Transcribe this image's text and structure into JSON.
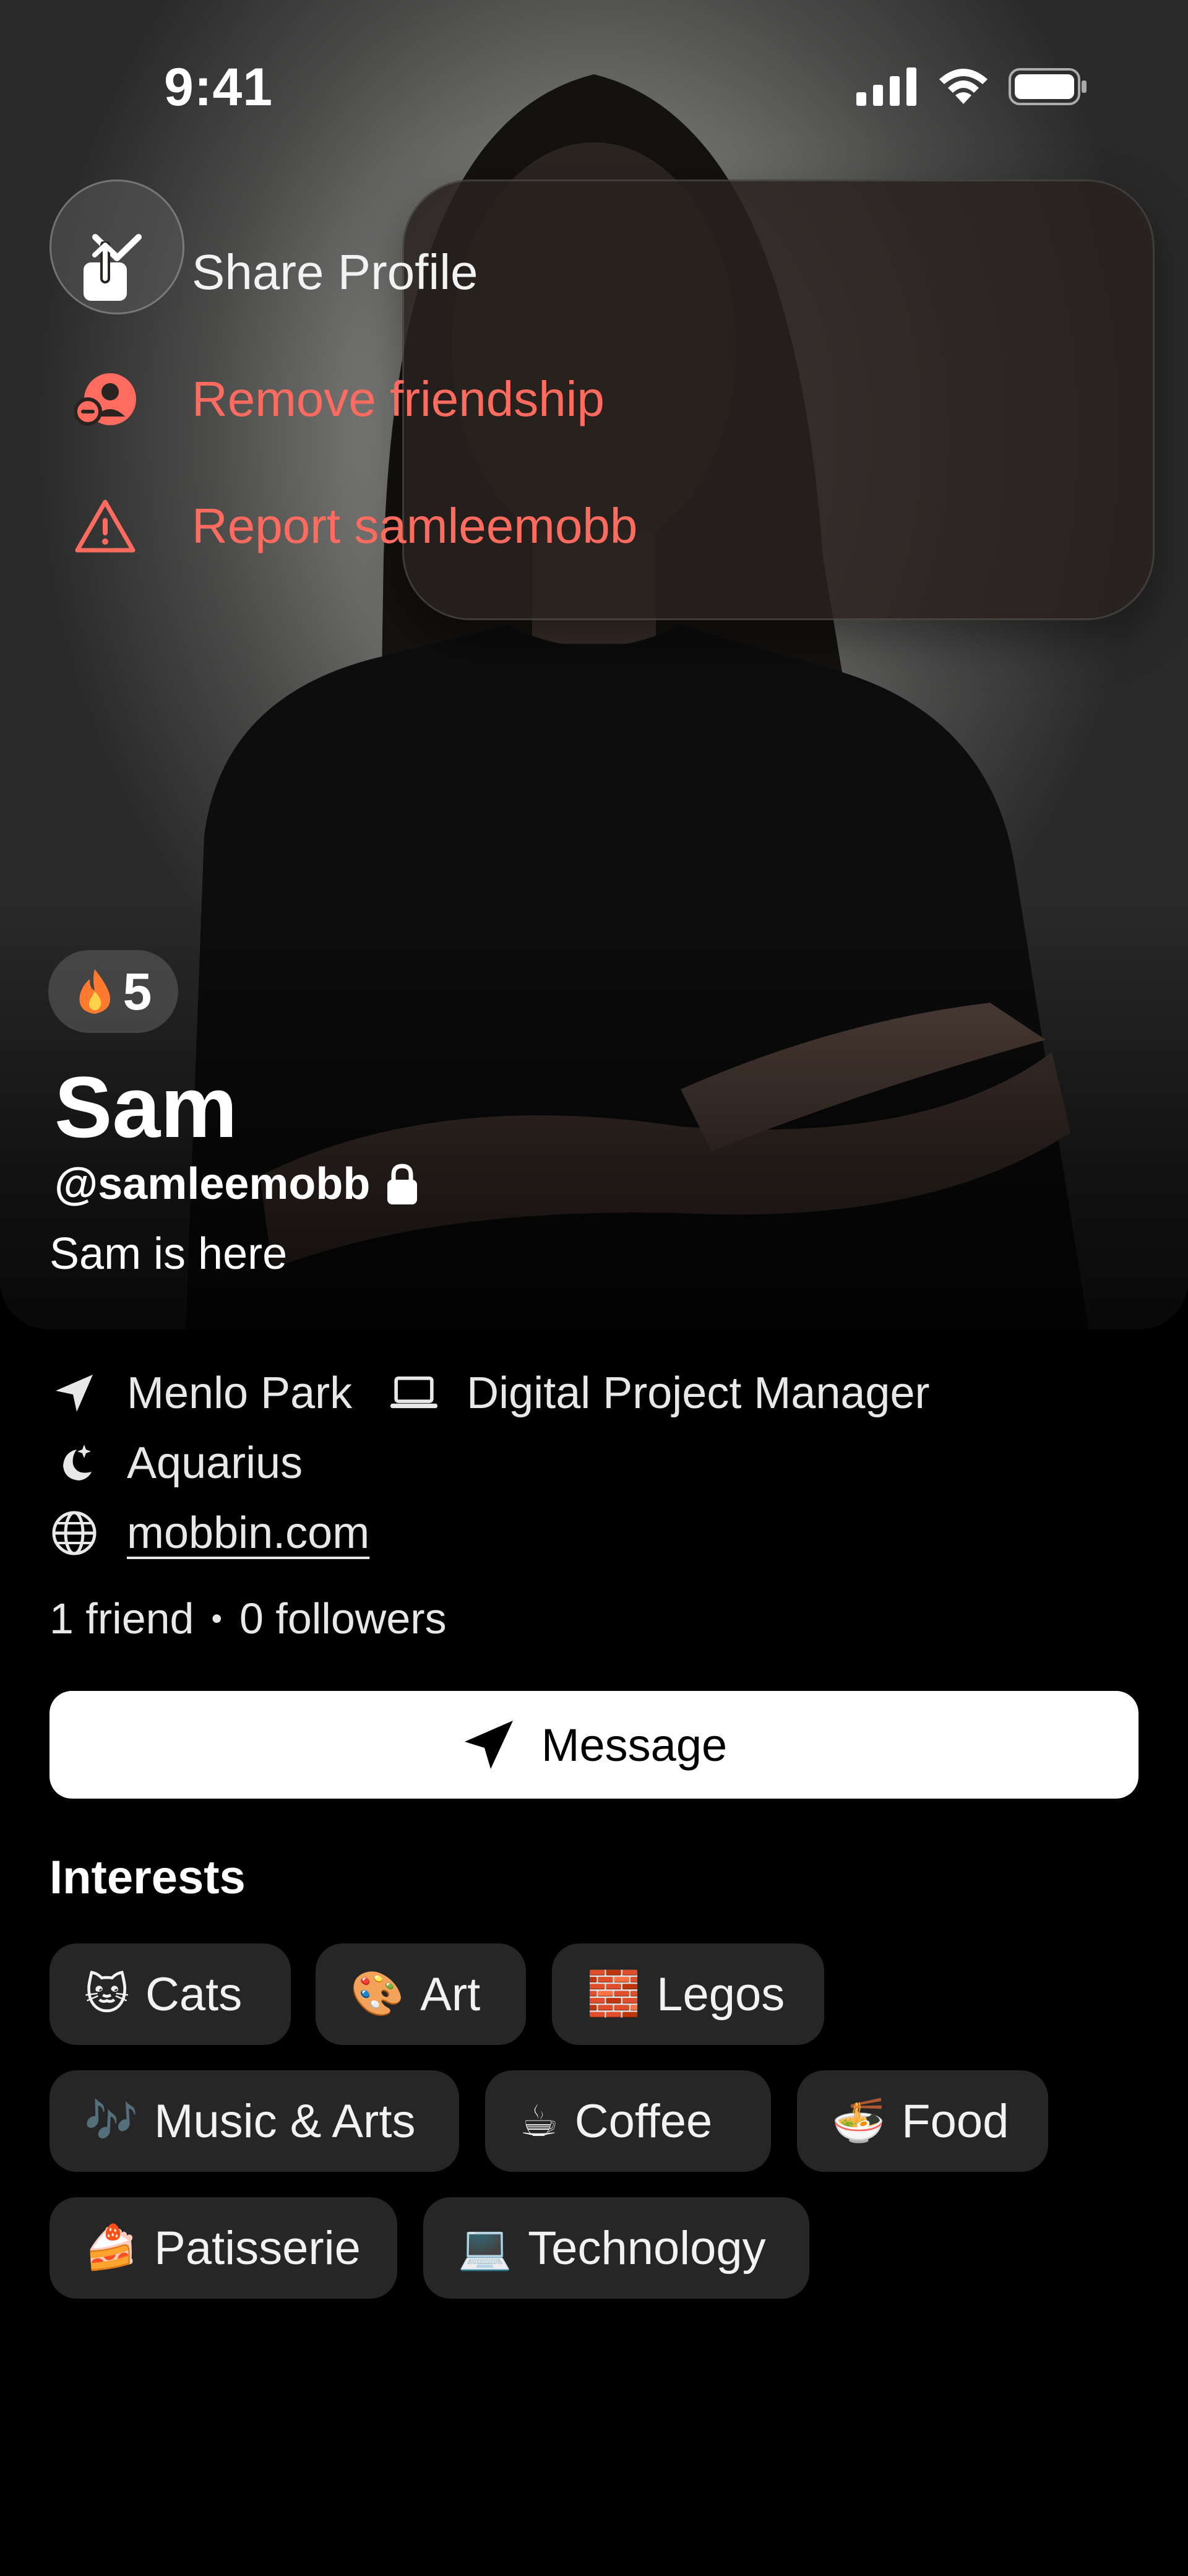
{
  "status_bar": {
    "time": "9:41"
  },
  "menu": {
    "items": [
      {
        "label": "Share Profile",
        "icon": "share-icon"
      },
      {
        "label": "Remove friendship",
        "icon": "remove-friend-icon"
      },
      {
        "label": "Report samleemobb",
        "icon": "warning-icon"
      }
    ]
  },
  "profile": {
    "streak": "5",
    "name": "Sam",
    "handle": "@samleemobb",
    "bio": "Sam is here",
    "location": "Menlo Park",
    "job": "Digital Project Manager",
    "zodiac": "Aquarius",
    "website": "mobbin.com",
    "friends": "1 friend",
    "separator": "•",
    "followers": "0 followers"
  },
  "actions": {
    "message_label": "Message"
  },
  "interests": {
    "title": "Interests",
    "items": [
      {
        "emoji": "🐱",
        "label": "Cats"
      },
      {
        "emoji": "🎨",
        "label": "Art"
      },
      {
        "emoji": "🧱",
        "label": "Legos"
      },
      {
        "emoji": "🎶",
        "label": "Music & Arts"
      },
      {
        "emoji": "☕",
        "label": "Coffee"
      },
      {
        "emoji": "🍜",
        "label": "Food"
      },
      {
        "emoji": "🍰",
        "label": "Patisserie"
      },
      {
        "emoji": "💻",
        "label": "Technology"
      }
    ]
  },
  "colors": {
    "danger": "#ff6b5e",
    "background": "#000000",
    "chip": "#262626"
  }
}
